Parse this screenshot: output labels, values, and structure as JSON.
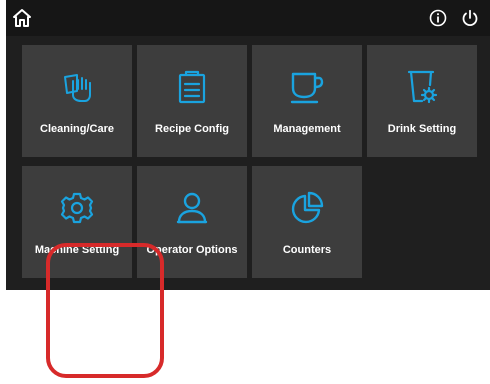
{
  "header": {
    "home_icon": "home-icon",
    "info_icon": "info-icon",
    "power_icon": "power-icon"
  },
  "accent_color": "#1aa3df",
  "tiles": [
    {
      "label": "Cleaning/Care",
      "icon": "hand-wash-icon"
    },
    {
      "label": "Recipe Config",
      "icon": "clipboard-icon"
    },
    {
      "label": "Management",
      "icon": "cup-icon"
    },
    {
      "label": "Drink Setting",
      "icon": "cup-settings-icon"
    },
    {
      "label": "Machine Setting",
      "icon": "gear-icon"
    },
    {
      "label": "Operator Options",
      "icon": "user-icon"
    },
    {
      "label": "Counters",
      "icon": "pie-chart-icon"
    }
  ],
  "annotation": {
    "color": "#d72a2a"
  }
}
